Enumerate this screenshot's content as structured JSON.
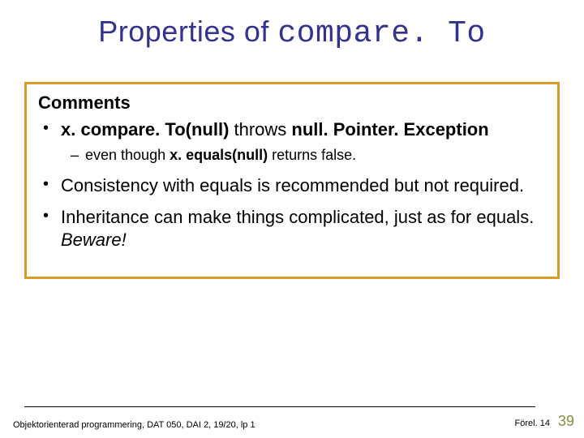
{
  "title_plain": "Properties of ",
  "title_mono": "compare. To",
  "comments_header": "Comments",
  "bullets": {
    "b1_a": "x. compare. To(null)",
    "b1_b": " throws ",
    "b1_c": "null. Pointer. Exception",
    "b1_sub_a": "even though ",
    "b1_sub_b": "x. equals(null)",
    "b1_sub_c": " returns false.",
    "b2": "Consistency with equals is recommended but not required.",
    "b3_a": "Inheritance can make things complicated, just as for equals. ",
    "b3_b": "Beware!"
  },
  "footer_left": "Objektorienterad programmering, DAT 050, DAI 2, 19/20, lp 1",
  "footer_mid": "Förel. 14",
  "page_number": "39"
}
